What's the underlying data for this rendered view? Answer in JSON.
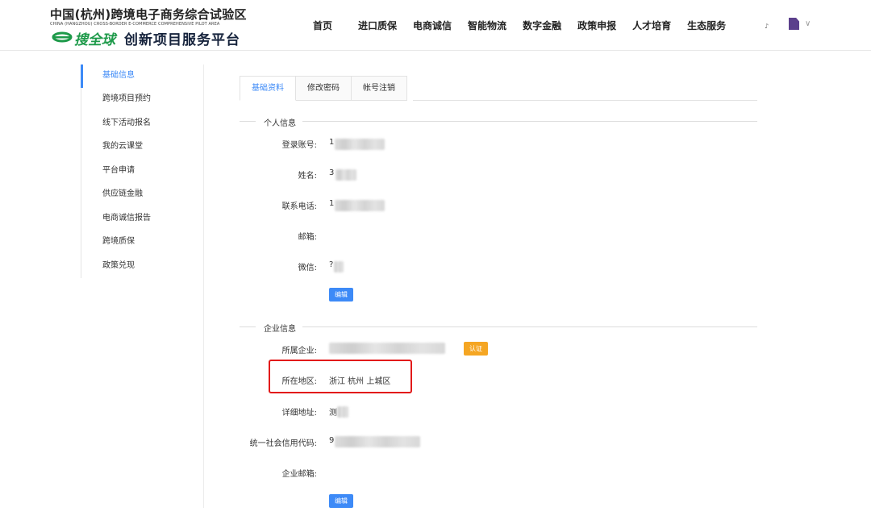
{
  "header": {
    "logo_title": "中国(杭州)跨境电子商务综合试验区",
    "logo_en": "CHINA (HANGZHOU) CROSS-BORDER E-COMMERCE COMPREHENSIVE PILOT AREA",
    "logo_brand": "搜全球",
    "logo_sub": "创新项目服务平台",
    "nav": [
      "首页",
      "进口质保",
      "电商诚信",
      "智能物流",
      "数字金融",
      "政策申报",
      "人才培育",
      "生态服务"
    ],
    "user_dot": "♪",
    "user_caret": "∨"
  },
  "sidebar": {
    "items": [
      "基础信息",
      "跨境项目预约",
      "线下活动报名",
      "我的云课堂",
      "平台申请",
      "供应链金融",
      "电商诚信报告",
      "跨境质保",
      "政策兑现"
    ],
    "active_index": 0
  },
  "tabs": [
    "基础资料",
    "修改密码",
    "帐号注销"
  ],
  "personal": {
    "title": "个人信息",
    "fields": [
      {
        "label": "登录账号:",
        "value": "1"
      },
      {
        "label": "姓名:",
        "value": "3"
      },
      {
        "label": "联系电话:",
        "value": "1"
      },
      {
        "label": "邮箱:",
        "value": ""
      },
      {
        "label": "微信:",
        "value": "?"
      }
    ],
    "edit_label": "编辑"
  },
  "company": {
    "title": "企业信息",
    "fields": [
      {
        "label": "所属企业:",
        "value": ""
      },
      {
        "label": "所在地区:",
        "value": "浙江  杭州  上城区"
      },
      {
        "label": "详细地址:",
        "value": "测"
      },
      {
        "label": "统一社会信用代码:",
        "value": "9"
      },
      {
        "label": "企业邮箱:",
        "value": ""
      }
    ],
    "cert_label": "认证",
    "edit_label": "编辑"
  },
  "colors": {
    "accent": "#3d8af7",
    "cert": "#f5a623",
    "highlight": "#e21a1a",
    "brand_green": "#1e9a4a"
  }
}
